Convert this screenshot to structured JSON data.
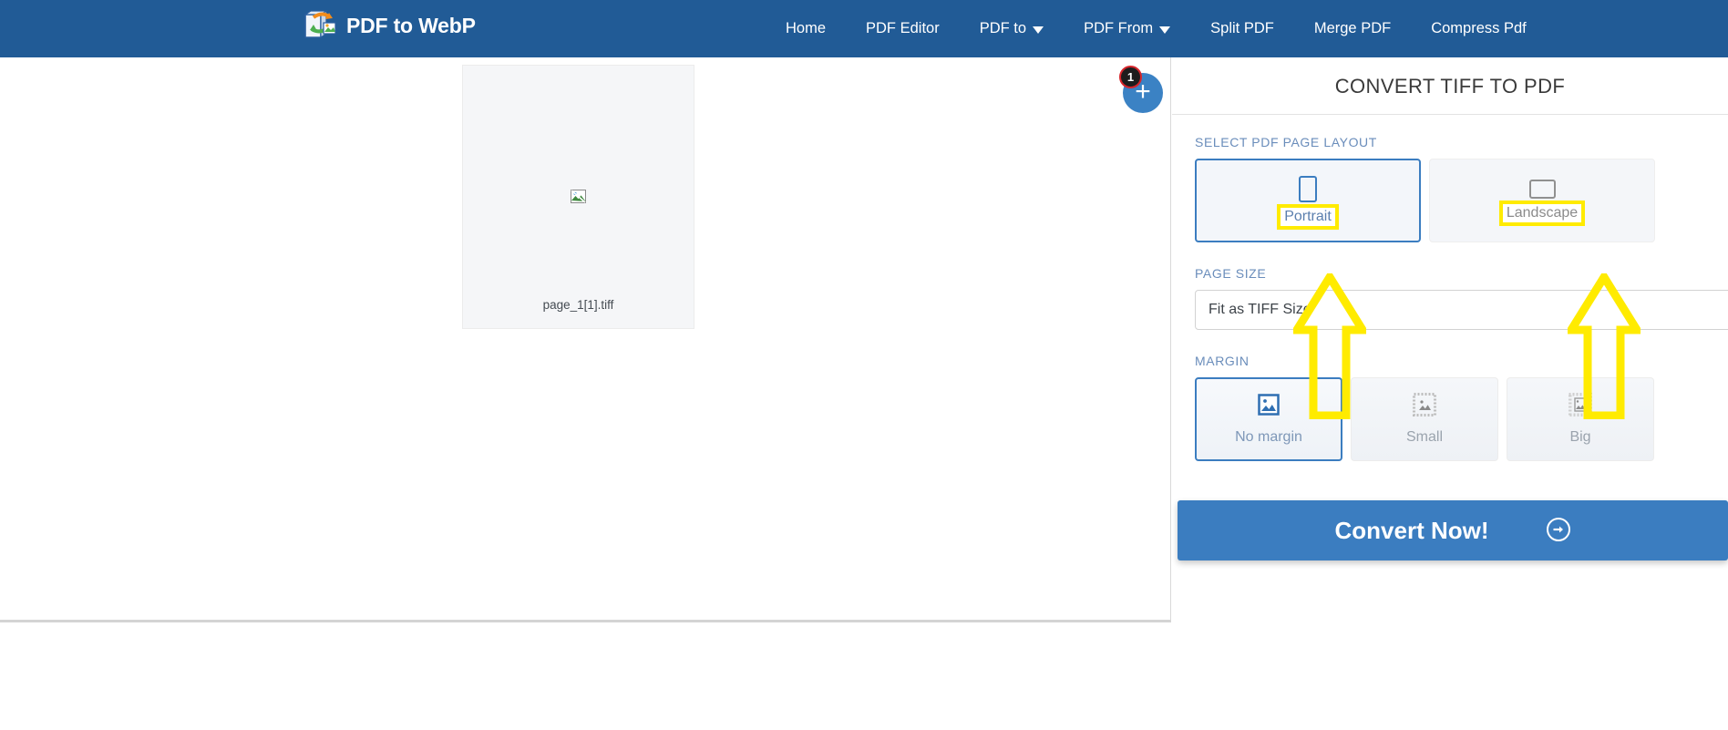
{
  "header": {
    "brand": {
      "text": "PDF to WebP",
      "icon": "pdf-to-webp-logo-icon"
    },
    "nav": [
      {
        "label": "Home",
        "has_dropdown": false
      },
      {
        "label": "PDF Editor",
        "has_dropdown": false
      },
      {
        "label": "PDF to",
        "has_dropdown": true
      },
      {
        "label": "PDF From",
        "has_dropdown": true
      },
      {
        "label": "Split PDF",
        "has_dropdown": false
      },
      {
        "label": "Merge PDF",
        "has_dropdown": false
      },
      {
        "label": "Compress Pdf",
        "has_dropdown": false
      }
    ],
    "background_color": "#215b96"
  },
  "workspace": {
    "file": {
      "name": "page_1[1].tiff",
      "thumbnail": "broken-image-icon"
    },
    "add_button": {
      "label": "+",
      "badge_count": "1"
    }
  },
  "panel": {
    "title": "CONVERT TIFF TO PDF",
    "layout": {
      "label": "SELECT PDF PAGE LAYOUT",
      "options": [
        {
          "label": "Portrait",
          "icon": "portrait-rect-icon",
          "selected": true,
          "highlighted": true
        },
        {
          "label": "Landscape",
          "icon": "landscape-rect-icon",
          "selected": false,
          "highlighted": true
        }
      ]
    },
    "page_size": {
      "label": "PAGE SIZE",
      "selected_value": "Fit as TIFF Size"
    },
    "margin": {
      "label": "MARGIN",
      "options": [
        {
          "label": "No margin",
          "icon": "image-no-margin-icon",
          "selected": true
        },
        {
          "label": "Small",
          "icon": "image-small-margin-icon",
          "selected": false
        },
        {
          "label": "Big",
          "icon": "image-big-margin-icon",
          "selected": false
        }
      ]
    },
    "convert_button": {
      "label": "Convert Now!",
      "icon": "arrow-circle-right-icon"
    }
  },
  "annotations": {
    "arrow_color": "#ffeb00",
    "highlight_color": "#ffeb00",
    "arrows": [
      {
        "points_to": "Portrait",
        "direction": "up"
      },
      {
        "points_to": "Landscape",
        "direction": "up"
      }
    ]
  },
  "colors": {
    "brand_blue": "#215b96",
    "accent_blue": "#3b7dc0",
    "label_blue": "#6a8dbb",
    "badge_red": "#d6252b"
  }
}
